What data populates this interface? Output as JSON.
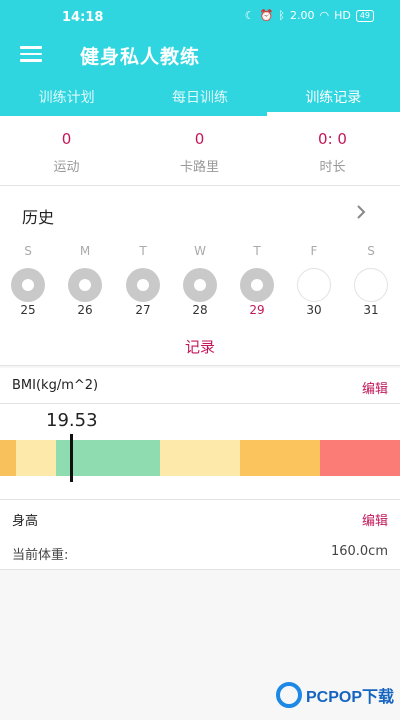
{
  "status": {
    "time": "14:18",
    "net_speed": "2.00",
    "network": "HD",
    "battery": "49"
  },
  "header": {
    "title": "健身私人教练"
  },
  "tabs": [
    {
      "label": "训练计划"
    },
    {
      "label": "每日训练"
    },
    {
      "label": "训练记录"
    }
  ],
  "stats": [
    {
      "value": "0",
      "label": "运动"
    },
    {
      "value": "0",
      "label": "卡路里"
    },
    {
      "value": "0: 0",
      "label": "时长"
    }
  ],
  "history": {
    "title": "历史",
    "weekdays": [
      "S",
      "M",
      "T",
      "W",
      "T",
      "F",
      "S"
    ],
    "days": [
      "25",
      "26",
      "27",
      "28",
      "29",
      "30",
      "31"
    ],
    "record_label": "记录"
  },
  "bmi": {
    "title": "BMI(kg/m^2)",
    "edit_label": "编辑",
    "value": "19.53",
    "scale_colors": [
      "#f8c15c",
      "#fde9a9",
      "#8edcaf",
      "#fde9a9",
      "#fcc45d",
      "#fb7b76"
    ]
  },
  "height": {
    "title": "身高",
    "edit_label": "编辑",
    "weight_label": "当前体重:",
    "weight_value": "160.0cm"
  },
  "watermark": {
    "text": "PCPOP下载"
  },
  "colors": {
    "primary": "#2fd6e0",
    "accent": "#c2185b"
  }
}
